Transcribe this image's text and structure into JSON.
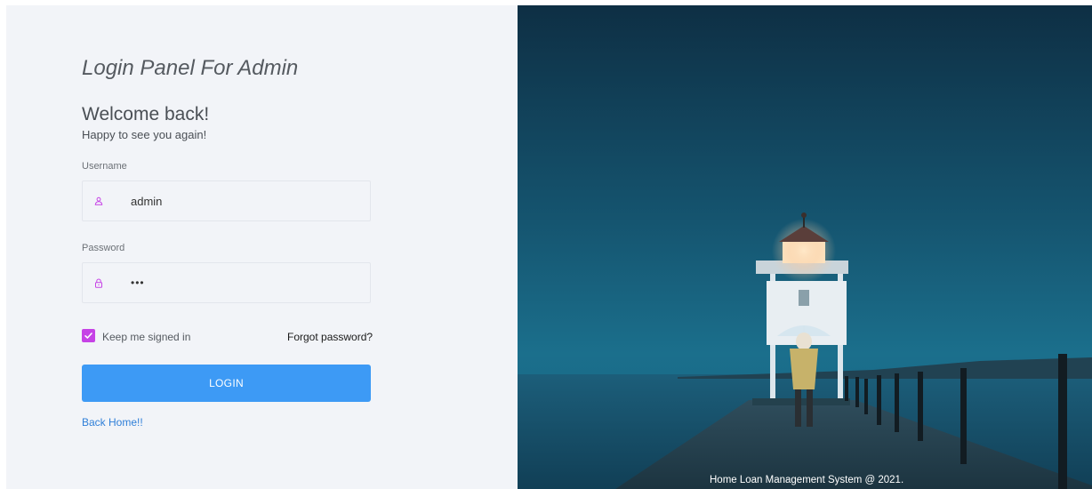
{
  "login": {
    "title": "Login Panel For Admin",
    "welcome": "Welcome back!",
    "subtitle": "Happy to see you again!",
    "username_label": "Username",
    "username_value": "admin",
    "password_label": "Password",
    "password_value": "•••",
    "keep_signed_in": "Keep me signed in",
    "keep_signed_in_checked": true,
    "forgot_password": "Forgot password?",
    "login_button": "LOGIN",
    "back_home": "Back Home!!"
  },
  "hero": {
    "caption": "Home Loan Management System @ 2021."
  },
  "colors": {
    "accent_button": "#3d9af5",
    "checkbox": "#c642e6",
    "icon": "#c642e6",
    "link": "#2f7fd8"
  },
  "icons": {
    "username": "user-icon",
    "password": "lock-icon",
    "checkbox": "check-icon"
  }
}
